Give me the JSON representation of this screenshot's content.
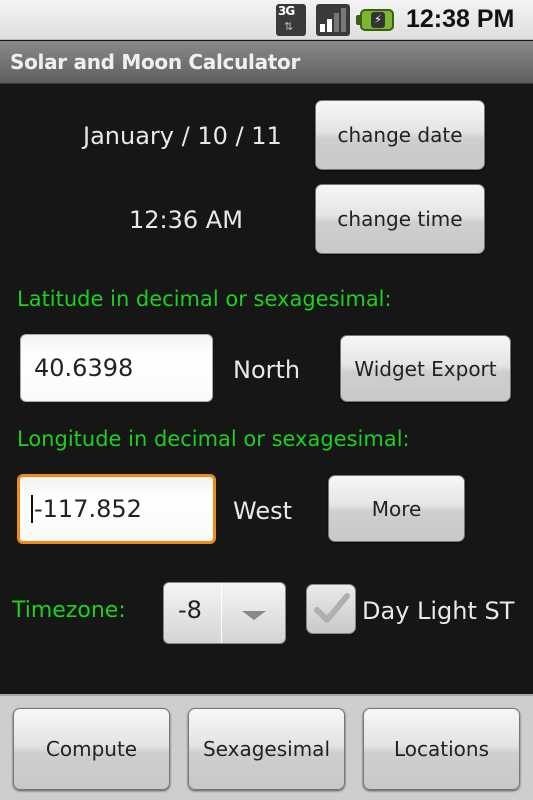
{
  "status_bar": {
    "network": "3G",
    "network_icon": "3g-data-icon",
    "signal_icon": "signal-strength-icon",
    "battery_icon": "battery-charging-icon",
    "time": "12:38 PM"
  },
  "app": {
    "title": "Solar and Moon Calculator"
  },
  "datetime": {
    "date_value": "January / 10 / 11",
    "change_date_label": "change date",
    "time_value": "12:36 AM",
    "change_time_label": "change time"
  },
  "latitude": {
    "label": "Latitude in decimal or sexagesimal:",
    "value": "40.6398",
    "hemisphere": "North",
    "widget_export_label": "Widget Export"
  },
  "longitude": {
    "label": "Longitude in decimal or sexagesimal:",
    "value": "-117.852",
    "hemisphere": "West",
    "more_label": "More"
  },
  "timezone": {
    "label": "Timezone:",
    "selected": "-8",
    "daylight_label": "Day Light ST",
    "daylight_checked": false
  },
  "bottom_bar": {
    "compute_label": "Compute",
    "sexagesimal_label": "Sexagesimal",
    "locations_label": "Locations"
  },
  "colors": {
    "accent_green": "#1ed01e",
    "focus_orange": "#f08a19"
  }
}
